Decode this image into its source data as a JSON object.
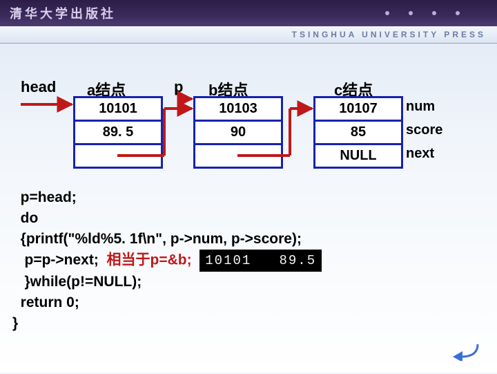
{
  "header": {
    "brand": "清华大学出版社",
    "sub": "TSINGHUA UNIVERSITY PRESS"
  },
  "labels": {
    "head": "head",
    "p": "p",
    "a": "a结点",
    "b": "b结点",
    "c": "c结点"
  },
  "fields": {
    "num": "num",
    "score": "score",
    "next": "next"
  },
  "nodes": {
    "a": {
      "num": "10101",
      "score": "89. 5",
      "next": ""
    },
    "b": {
      "num": "10103",
      "score": "90",
      "next": ""
    },
    "c": {
      "num": "10107",
      "score": "85",
      "next": "NULL"
    }
  },
  "code": {
    "l1": "  p=head;",
    "l2": "  do",
    "l3": "  {printf(\"%ld%5. 1f\\n\", p->num, p->score);",
    "l4a": "   p=p->next;  ",
    "l4b": "相当于p=&b;",
    "l5": "   }while(p!=NULL);",
    "l6": "  return 0;",
    "l7": "}"
  },
  "console": "10101   89.5",
  "colors": {
    "border": "#1622b0",
    "arrow": "#c01818"
  }
}
